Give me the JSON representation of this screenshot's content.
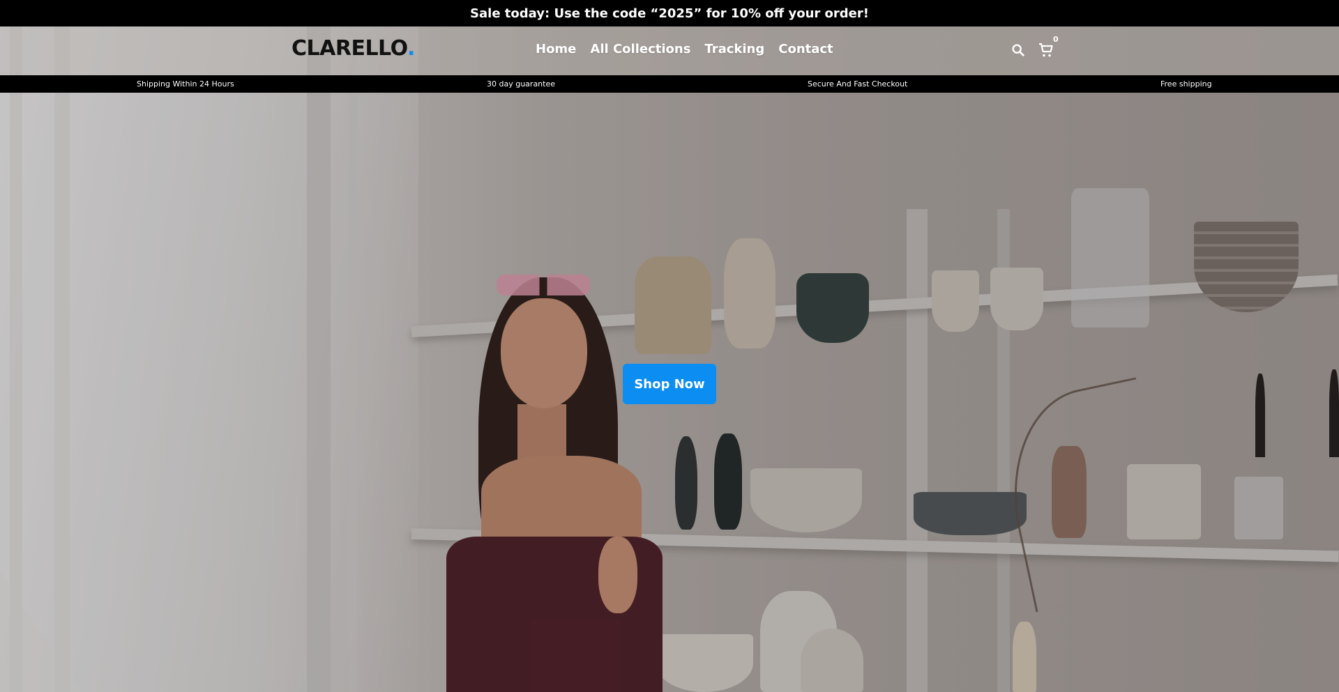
{
  "announcement": {
    "text": "Sale today: Use the code “2025” for 10% off your order!"
  },
  "header": {
    "logo_text": "CLARELLO",
    "logo_dot": ".",
    "nav": [
      {
        "label": "Home"
      },
      {
        "label": "All Collections"
      },
      {
        "label": "Tracking"
      },
      {
        "label": "Contact"
      }
    ],
    "icons": {
      "search": "search-icon",
      "cart": "cart-icon"
    },
    "cart_count": "0"
  },
  "features": [
    {
      "label": "Shipping Within 24 Hours"
    },
    {
      "label": "30 day guarantee"
    },
    {
      "label": "Secure And Fast Checkout"
    },
    {
      "label": "Free shipping"
    }
  ],
  "hero": {
    "cta_label": "Shop Now"
  },
  "colors": {
    "accent": "#0b8df2",
    "bar_background": "#000000",
    "nav_text": "#ffffff"
  }
}
